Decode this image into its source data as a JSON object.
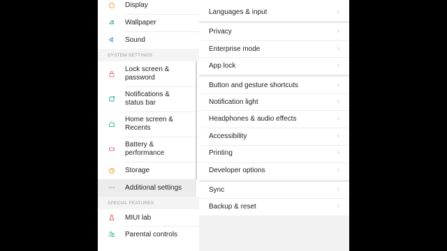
{
  "left_panel": {
    "items_top": [
      {
        "label": "Display",
        "icon": "display-icon",
        "color": "#f0a030"
      },
      {
        "label": "Wallpaper",
        "icon": "wallpaper-icon",
        "color": "#2aa8a0"
      },
      {
        "label": "Sound",
        "icon": "sound-icon",
        "color": "#3a8fd0"
      }
    ],
    "system_settings_header": "SYSTEM SETTINGS",
    "items_system": [
      {
        "label1": "Lock screen &",
        "label2": "password",
        "icon": "lock-icon",
        "color": "#e47a7a"
      },
      {
        "label1": "Notifications &",
        "label2": "status bar",
        "icon": "notification-icon",
        "color": "#2aa8a0"
      },
      {
        "label1": "Home screen &",
        "label2": "Recents",
        "icon": "home-icon",
        "color": "#3cbf7a"
      },
      {
        "label1": "Battery &",
        "label2": "performance",
        "icon": "battery-icon",
        "color": "#d070c0"
      },
      {
        "label1": "Storage",
        "label2": "",
        "icon": "storage-icon",
        "color": "#f0a030"
      },
      {
        "label1": "Additional settings",
        "label2": "",
        "icon": "more-icon",
        "color": "#888888"
      }
    ],
    "special_features_header": "SPECIAL FEATURES",
    "items_special": [
      {
        "label": "MIUI lab",
        "icon": "lab-icon",
        "color": "#f06060"
      },
      {
        "label": "Parental controls",
        "icon": "parental-icon",
        "color": "#3cbf7a"
      }
    ]
  },
  "right_panel": {
    "group1": [
      "Languages & input"
    ],
    "group2": [
      "Privacy",
      "Enterprise mode",
      "App lock"
    ],
    "group3": [
      "Button and gesture shortcuts",
      "Notification light",
      "Headphones & audio effects",
      "Accessibility",
      "Printing",
      "Developer options"
    ],
    "group4": [
      "Sync",
      "Backup & reset"
    ],
    "chevron": "›"
  }
}
